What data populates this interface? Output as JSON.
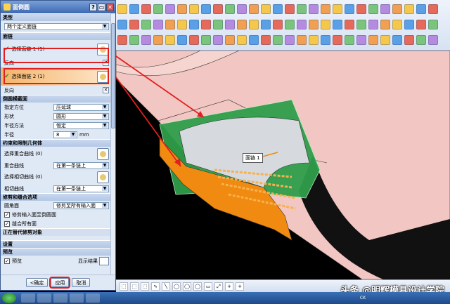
{
  "dialog": {
    "title": "面倒圆",
    "win_buttons": [
      "?",
      "▭",
      "✕"
    ],
    "type_section": "类型",
    "type_value": "两个定义面链",
    "face_section": "面链",
    "select_face1": "选择面链 1 (1)",
    "reverse1": "反向",
    "select_face2": "选择面链 2 (1)",
    "reverse2": "反向",
    "cross_section": "倒圆横截面",
    "orientation_label": "指定方位",
    "orientation_value": "压延球",
    "shape_label": "形状",
    "shape_value": "圆形",
    "radius_method_label": "半径方法",
    "radius_method_value": "恒定",
    "radius_label": "半径",
    "radius_value": "8",
    "radius_unit": "mm",
    "constraint_section": "约束和限制几何体",
    "select_overlap_curve": "选择重合曲线 (0)",
    "overlap_curve_label": "重合曲线",
    "overlap_curve_value": "在第一条链上",
    "select_tangent_curve": "选择相切曲线 (0)",
    "tangent_curve_label": "相切曲线",
    "tangent_curve_value": "在第一条链上",
    "trim_section": "修剪和缝合选项",
    "fillet_face_label": "圆角面",
    "fillet_face_value": "修剪至所有输入面",
    "trim_input_label": "修剪输入面至倒圆面",
    "stitch_label": "缝合所有面",
    "trim_target_label": "正在替代修剪对象",
    "settings_section": "设置",
    "preview_section": "预览",
    "preview_check": "预览",
    "show_result": "显示结果",
    "ok": "<确定",
    "apply": "应用",
    "cancel": "取消"
  },
  "viewport": {
    "face_label": "面链 1",
    "colors": {
      "pink": "#f2c6c2",
      "green": "#2f9e4a",
      "orange": "#f08a10",
      "highlight_red": "#e02020"
    }
  },
  "bottom_toolbar": {
    "items": [
      "⬚",
      "⬚",
      "⬚",
      "∿",
      "╲",
      "◯",
      "◯",
      "◯",
      "▭",
      "⤢",
      "+",
      "+"
    ],
    "watermark": "头条 @明辉模具设计学院"
  },
  "taskbar": {
    "clock_text": "CK"
  }
}
